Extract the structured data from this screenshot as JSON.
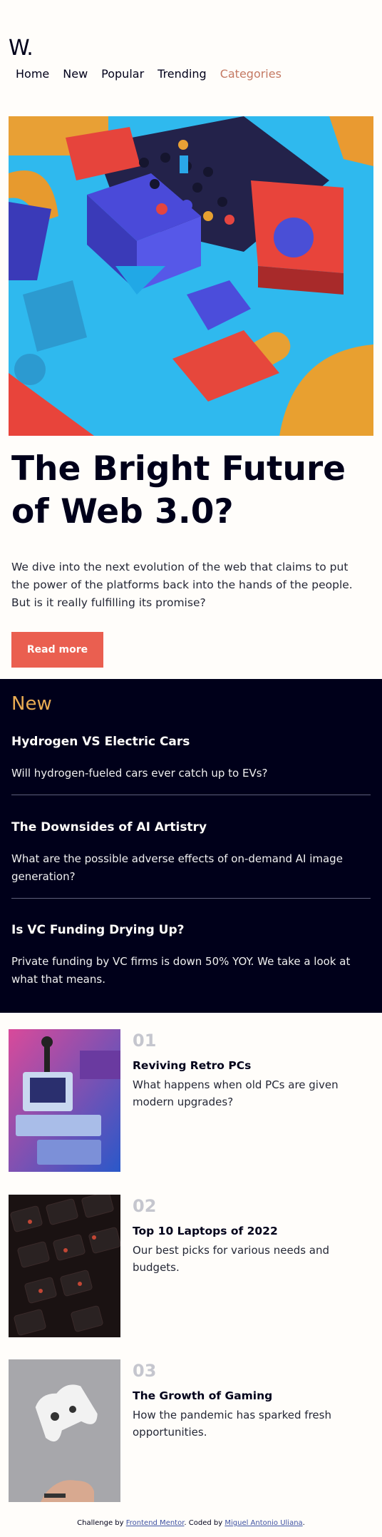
{
  "header": {
    "logo": "W.",
    "nav": [
      "Home",
      "New",
      "Popular",
      "Trending",
      "Categories"
    ]
  },
  "hero": {
    "image": "abstract-colorful-3d-blocks",
    "headline": "The Bright Future of Web 3.0?",
    "intro": "We dive into the next evolution of the web that claims to put the power of the platforms back into the hands of the people. But is it really fulfilling its promise?",
    "cta": "Read more"
  },
  "new": {
    "title": "New",
    "items": [
      {
        "title": "Hydrogen VS Electric Cars",
        "desc": "Will hydrogen-fueled cars ever catch up to EVs?"
      },
      {
        "title": "The Downsides of AI Artistry",
        "desc": "What are the possible adverse effects of on-demand AI image generation?"
      },
      {
        "title": "Is VC Funding Drying Up?",
        "desc": "Private funding by VC firms is down 50% YOY. We take a look at what that means."
      }
    ]
  },
  "articles": [
    {
      "num": "01",
      "title": "Reviving Retro PCs",
      "desc": "What happens when old PCs are given modern upgrades?",
      "image": "retro-pc"
    },
    {
      "num": "02",
      "title": "Top 10 Laptops of 2022",
      "desc": "Our best picks for various needs and budgets.",
      "image": "laptop-keyboard"
    },
    {
      "num": "03",
      "title": "The Growth of Gaming",
      "desc": "How the pandemic has sparked fresh opportunities.",
      "image": "game-controller"
    }
  ],
  "footer": {
    "prefix": "Challenge by ",
    "link1": "Frontend Mentor",
    "middle": ". Coded by ",
    "link2": "Miguel Antonio Uliana",
    "suffix": "."
  },
  "colors": {
    "accent": "#ea5f50",
    "nav_accent": "#c47963",
    "dark": "#00001a",
    "gold": "#e9ab53"
  }
}
